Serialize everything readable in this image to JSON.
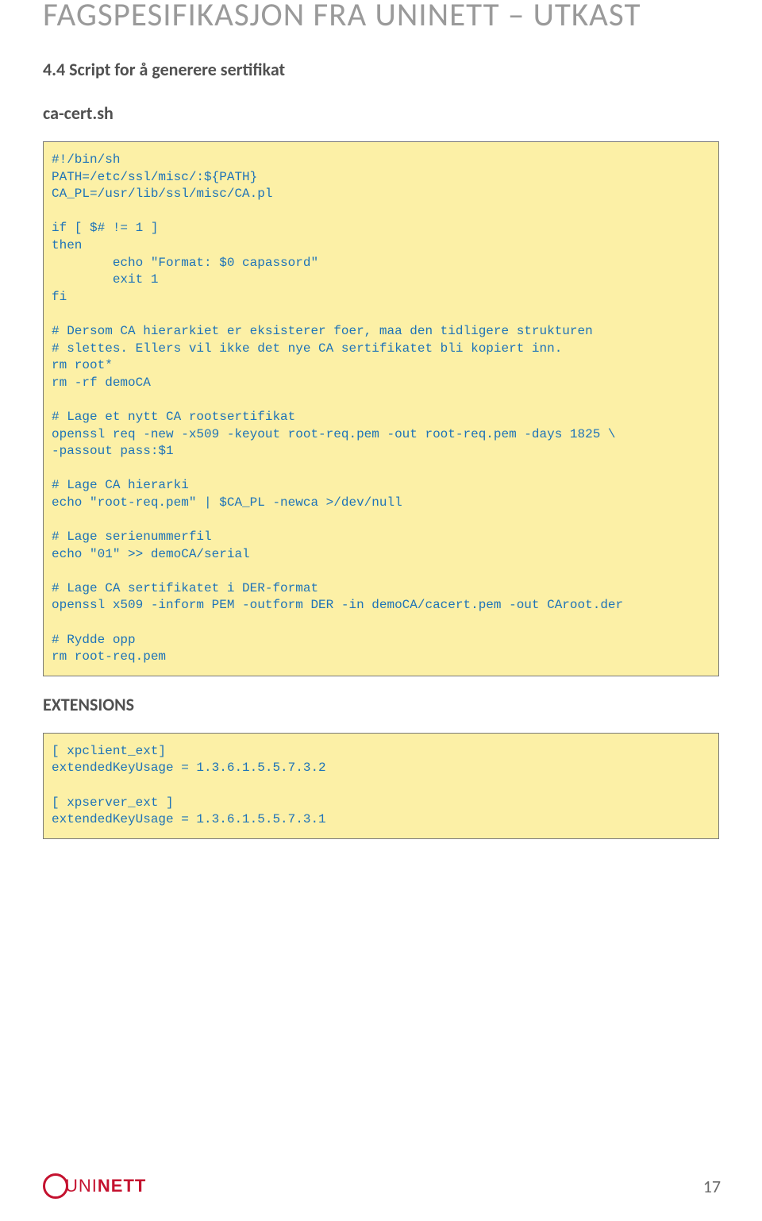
{
  "header": "FAGSPESIFIKASJON FRA UNINETT – UTKAST",
  "section_heading": "4.4 Script for å generere sertifikat",
  "filename": "ca-cert.sh",
  "code_block_1": "#!/bin/sh\nPATH=/etc/ssl/misc/:${PATH}\nCA_PL=/usr/lib/ssl/misc/CA.pl\n\nif [ $# != 1 ]\nthen\n        echo \"Format: $0 capassord\"\n        exit 1\nfi\n\n# Dersom CA hierarkiet er eksisterer foer, maa den tidligere strukturen\n# slettes. Ellers vil ikke det nye CA sertifikatet bli kopiert inn.\nrm root*\nrm -rf demoCA\n\n# Lage et nytt CA rootsertifikat\nopenssl req -new -x509 -keyout root-req.pem -out root-req.pem -days 1825 \\\n-passout pass:$1\n\n# Lage CA hierarki\necho \"root-req.pem\" | $CA_PL -newca >/dev/null\n\n# Lage serienummerfil\necho \"01\" >> demoCA/serial\n\n# Lage CA sertifikatet i DER-format\nopenssl x509 -inform PEM -outform DER -in demoCA/cacert.pem -out CAroot.der\n\n# Rydde opp\nrm root-req.pem",
  "extensions_heading": "EXTENSIONS",
  "code_block_2": "[ xpclient_ext]\nextendedKeyUsage = 1.3.6.1.5.5.7.3.2\n\n[ xpserver_ext ]\nextendedKeyUsage = 1.3.6.1.5.5.7.3.1",
  "logo": {
    "part1": "UNI",
    "part2": "NETT"
  },
  "page_number": "17"
}
